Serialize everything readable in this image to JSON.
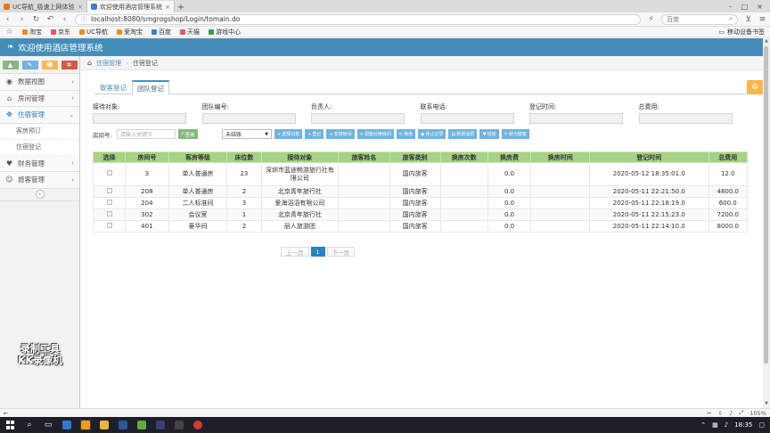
{
  "browser": {
    "tabs": [
      {
        "label": "UC导航_极速上网体验",
        "active": false
      },
      {
        "label": "欢迎使用酒店管理系统",
        "active": true
      }
    ],
    "new_tab": "+",
    "url": "localhost:8080/smgrogshop/Login/tomain.do",
    "search_placeholder": "百度",
    "bookmarks": [
      "淘宝",
      "京东",
      "UC导航",
      "爱淘宝",
      "百度",
      "天猫",
      "游戏中心"
    ],
    "bookmarks_right": "移动设备书签",
    "zoom": "105%"
  },
  "app": {
    "title": "欢迎使用酒店管理系统"
  },
  "sidebar": {
    "items": [
      {
        "label": "数据视图",
        "icon": "dashboard-icon",
        "arrow": "‹"
      },
      {
        "label": "房间管理",
        "icon": "home-icon",
        "arrow": "‹"
      },
      {
        "label": "住宿管理",
        "icon": "move-icon",
        "arrow": "⌄",
        "open": true
      },
      {
        "label": "财务管理",
        "icon": "heart-icon",
        "arrow": "‹"
      },
      {
        "label": "旅客管理",
        "icon": "user-icon",
        "arrow": "‹"
      }
    ],
    "subitems": [
      "客房预订",
      "住宿登记"
    ],
    "collapse": "«"
  },
  "breadcrumb": {
    "parent": "住宿管理",
    "current": "住宿登记"
  },
  "tabs": [
    {
      "label": "散客登记",
      "active": false
    },
    {
      "label": "团队登记",
      "active": true
    }
  ],
  "form": {
    "fields": [
      {
        "label": "接待对象:"
      },
      {
        "label": "团队编号:"
      },
      {
        "label": "负责人:"
      },
      {
        "label": "联系电话:"
      },
      {
        "label": "登记时间:"
      },
      {
        "label": "总费用:"
      }
    ]
  },
  "toolbar": {
    "room_label": "房间号:",
    "room_placeholder": "请输入关键字",
    "search_btn": "查询",
    "status_select": "未结账",
    "buttons": [
      "选择对象",
      "登记",
      "安排房间",
      "调整对换房间",
      "换房",
      "停止记录",
      "新增消费",
      "结账",
      "转为散客"
    ]
  },
  "table": {
    "headers": [
      "选择",
      "房间号",
      "客房等级",
      "床位数",
      "接待对象",
      "旅客姓名",
      "旅客类别",
      "换房次数",
      "换房费",
      "换房时间",
      "登记时间",
      "总费用"
    ],
    "rows": [
      [
        "",
        "3",
        "单人普通房",
        "23",
        "深圳市蓝途畅游旅行社有限公司",
        "",
        "国内旅客",
        "",
        "0.0",
        "",
        "2020-05-12 18:35:01.0",
        "12.0"
      ],
      [
        "",
        "208",
        "单人普通房",
        "2",
        "北京青年旅行社",
        "",
        "国内旅客",
        "",
        "0.0",
        "",
        "2020-05-11 22:21:50.0",
        "4800.0"
      ],
      [
        "",
        "204",
        "二人标准间",
        "3",
        "爱海滔滔有限公司",
        "",
        "国内旅客",
        "",
        "0.0",
        "",
        "2020-05-11 22:18:19.0",
        "600.0"
      ],
      [
        "",
        "302",
        "会议室",
        "1",
        "北京青年旅行社",
        "",
        "国内旅客",
        "",
        "0.0",
        "",
        "2020-05-11 22:15:23.0",
        "7200.0"
      ],
      [
        "",
        "401",
        "豪华间",
        "2",
        "丽人旅游团",
        "",
        "国内旅客",
        "",
        "0.0",
        "",
        "2020-05-11 22:14:10.0",
        "8000.0"
      ]
    ]
  },
  "pager": {
    "prev": "上一页",
    "current": "1",
    "next": "下一页"
  },
  "watermark": {
    "line1": "录制工具",
    "line2": "KK录像机"
  },
  "taskbar": {
    "clock": "18:35"
  }
}
